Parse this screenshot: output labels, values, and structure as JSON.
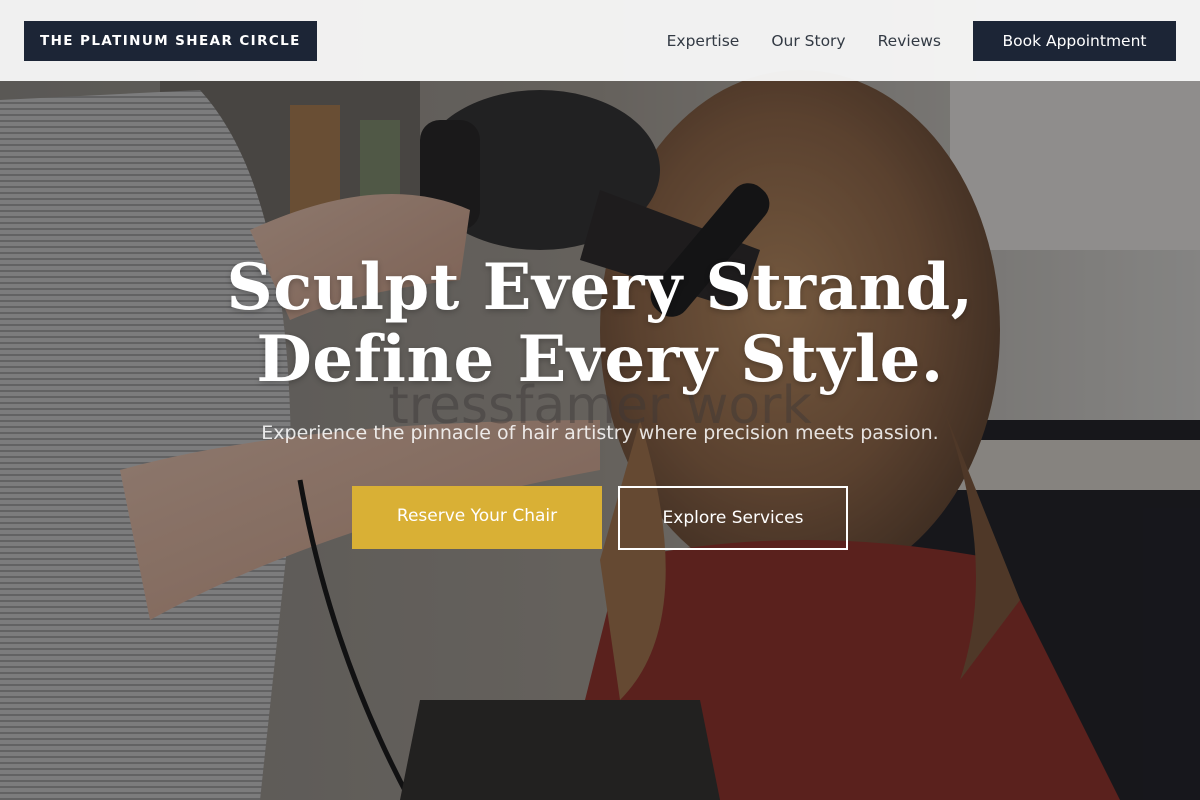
{
  "header": {
    "brand": "THE PLATINUM SHEAR CIRCLE",
    "nav": [
      "Expertise",
      "Our Story",
      "Reviews"
    ],
    "cta": "Book Appointment"
  },
  "hero": {
    "background": "hairstylist-blow-drying-client-photo",
    "headline_line1": "Sculpt Every Strand,",
    "headline_line2": "Define Every Style.",
    "overlay_text": "tressfamer work",
    "tagline": "Experience the pinnacle of hair artistry where precision meets passion.",
    "primary_button": "Reserve Your Chair",
    "secondary_button": "Explore Services"
  },
  "colors": {
    "navy": "#1c2536",
    "gold": "#d9b035",
    "header_bg": "#f7f7f7",
    "white": "#ffffff"
  }
}
